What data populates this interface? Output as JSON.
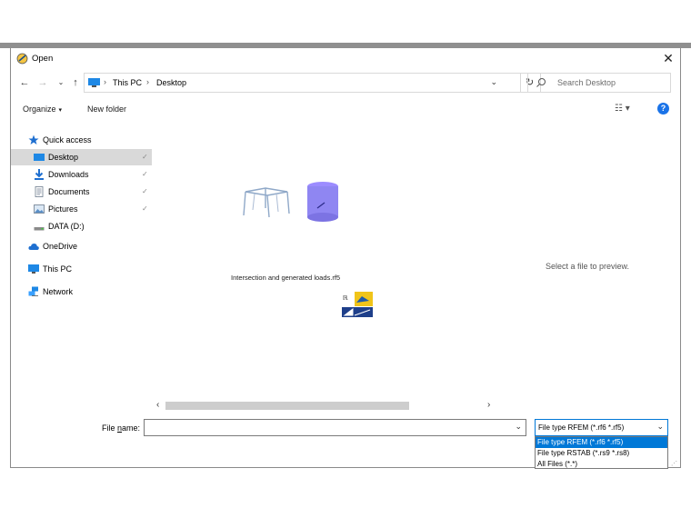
{
  "window": {
    "title": "Open",
    "close_glyph": "✕"
  },
  "nav": {
    "back": "←",
    "forward": "→",
    "recent": "⌄",
    "up": "↑",
    "breadcrumb": [
      "This PC",
      "Desktop"
    ],
    "address_dropdown": "⌄",
    "refresh": "↻",
    "search_placeholder": "Search Desktop"
  },
  "toolbar": {
    "organize_label": "Organize",
    "organize_caret": "▾",
    "new_folder_label": "New folder",
    "view_glyph": "☷ ▾",
    "help_glyph": "?"
  },
  "sidebar": {
    "items": [
      {
        "label": "Quick access",
        "icon": "star-icon"
      },
      {
        "label": "Desktop",
        "icon": "desktop-icon",
        "pinned": true,
        "selected": true
      },
      {
        "label": "Downloads",
        "icon": "download-icon",
        "pinned": true
      },
      {
        "label": "Documents",
        "icon": "documents-icon",
        "pinned": true
      },
      {
        "label": "Pictures",
        "icon": "pictures-icon",
        "pinned": true
      },
      {
        "label": "DATA (D:)",
        "icon": "drive-icon"
      },
      {
        "label": "OneDrive",
        "icon": "cloud-icon"
      },
      {
        "label": "This PC",
        "icon": "computer-icon"
      },
      {
        "label": "Network",
        "icon": "network-icon"
      }
    ],
    "pin_glyph": "📌"
  },
  "files": [
    {
      "name": "Intersection and generated loads.rf5"
    }
  ],
  "preview_text": "Select a file to preview.",
  "scroll": {
    "left": "‹",
    "right": "›"
  },
  "footer": {
    "file_name_label_prefix": "File ",
    "file_name_label_underline": "n",
    "file_name_label_suffix": "ame:",
    "file_name_value": "",
    "file_type_selected": "File type RFEM (*.rf6 *.rf5)",
    "file_type_options": [
      "File type RFEM (*.rf6 *.rf5)",
      "File type RSTAB (*.rs9 *.rs8)",
      "All Files (*.*)"
    ],
    "dropdown_glyph": "⌄"
  },
  "colors": {
    "accent": "#0078d7",
    "selected_row": "#d9d9d9",
    "help": "#1a73e8"
  }
}
